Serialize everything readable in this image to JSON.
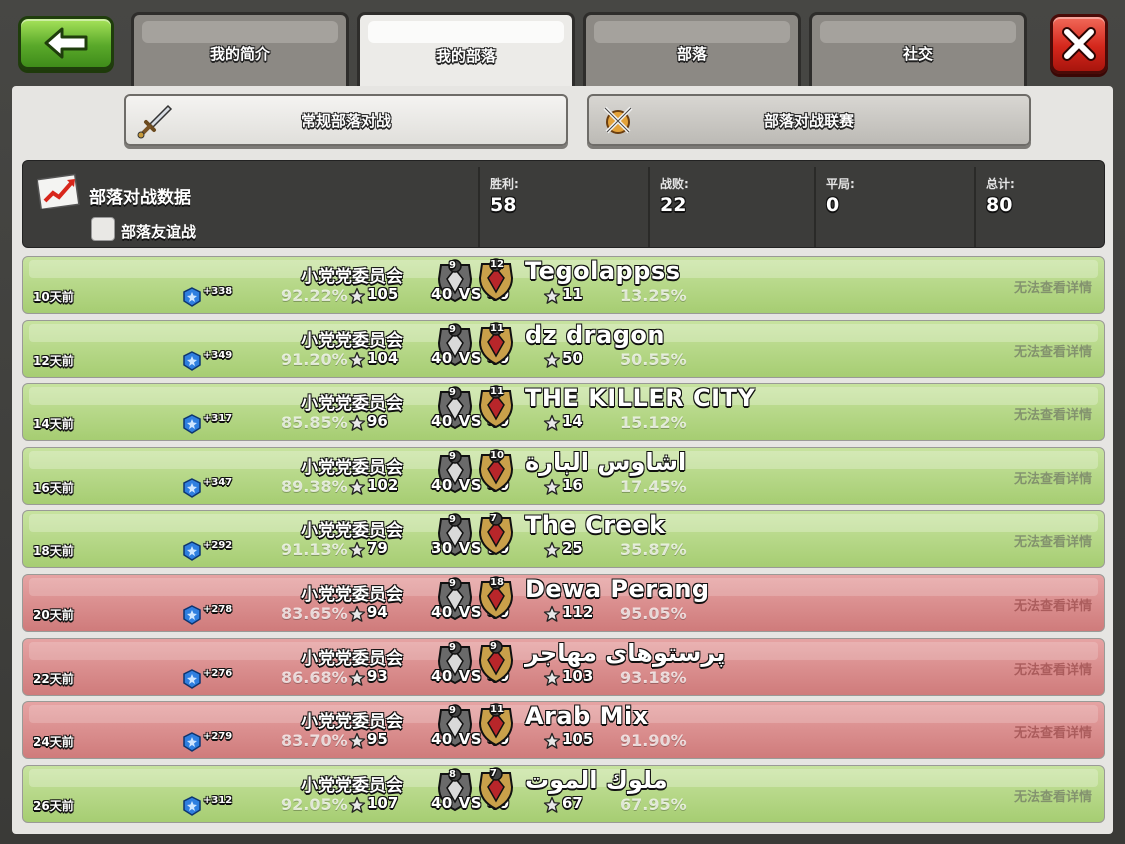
{
  "tabs": [
    {
      "label": "我的简介",
      "active": false
    },
    {
      "label": "我的部落",
      "active": true
    },
    {
      "label": "部落",
      "active": false
    },
    {
      "label": "社交",
      "active": false
    }
  ],
  "subtabs": {
    "regular": {
      "label": "常规部落对战",
      "icon": "sword-icon"
    },
    "league": {
      "label": "部落对战联赛",
      "icon": "crossed-swords-icon"
    }
  },
  "stats": {
    "title": "部落对战数据",
    "friendly_label": "部落友谊战",
    "friendly_checked": false,
    "win_label": "胜利:",
    "win": "58",
    "loss_label": "战败:",
    "loss": "22",
    "draw_label": "平局:",
    "draw": "0",
    "total_label": "总计:",
    "total": "80"
  },
  "colors": {
    "win_row": "#b7d98a",
    "lose_row": "#db8f8f",
    "back_button": "#5aa92a",
    "close_button": "#d4271c"
  },
  "wars": [
    {
      "result": "win",
      "ago": "10天前",
      "xp": "+338",
      "our_name": "小党党委员会",
      "our_pct": "92.22%",
      "our_stars": "105",
      "our_level": "9",
      "vs": "40 VS 40",
      "enemy_level": "12",
      "enemy_name": "Tegolappss",
      "enemy_stars": "11",
      "enemy_pct": "13.25%",
      "detail": "无法查看详情"
    },
    {
      "result": "win",
      "ago": "12天前",
      "xp": "+349",
      "our_name": "小党党委员会",
      "our_pct": "91.20%",
      "our_stars": "104",
      "our_level": "9",
      "vs": "40 VS 40",
      "enemy_level": "11",
      "enemy_name": "dz dragon",
      "enemy_stars": "50",
      "enemy_pct": "50.55%",
      "detail": "无法查看详情"
    },
    {
      "result": "win",
      "ago": "14天前",
      "xp": "+317",
      "our_name": "小党党委员会",
      "our_pct": "85.85%",
      "our_stars": "96",
      "our_level": "9",
      "vs": "40 VS 40",
      "enemy_level": "11",
      "enemy_name": "THE KILLER CITY",
      "enemy_stars": "14",
      "enemy_pct": "15.12%",
      "detail": "无法查看详情"
    },
    {
      "result": "win",
      "ago": "16天前",
      "xp": "+347",
      "our_name": "小党党委员会",
      "our_pct": "89.38%",
      "our_stars": "102",
      "our_level": "9",
      "vs": "40 VS 40",
      "enemy_level": "10",
      "enemy_name": "اشاوس البارة",
      "enemy_stars": "16",
      "enemy_pct": "17.45%",
      "detail": "无法查看详情"
    },
    {
      "result": "win",
      "ago": "18天前",
      "xp": "+292",
      "our_name": "小党党委员会",
      "our_pct": "91.13%",
      "our_stars": "79",
      "our_level": "9",
      "vs": "30 VS 30",
      "enemy_level": "7",
      "enemy_name": "The Creek",
      "enemy_stars": "25",
      "enemy_pct": "35.87%",
      "detail": "无法查看详情"
    },
    {
      "result": "lose",
      "ago": "20天前",
      "xp": "+278",
      "our_name": "小党党委员会",
      "our_pct": "83.65%",
      "our_stars": "94",
      "our_level": "9",
      "vs": "40 VS 40",
      "enemy_level": "18",
      "enemy_name": "Dewa Perang",
      "enemy_stars": "112",
      "enemy_pct": "95.05%",
      "detail": "无法查看详情"
    },
    {
      "result": "lose",
      "ago": "22天前",
      "xp": "+276",
      "our_name": "小党党委员会",
      "our_pct": "86.68%",
      "our_stars": "93",
      "our_level": "9",
      "vs": "40 VS 40",
      "enemy_level": "9",
      "enemy_name": "پرستوهای مهاجر",
      "enemy_stars": "103",
      "enemy_pct": "93.18%",
      "detail": "无法查看详情"
    },
    {
      "result": "lose",
      "ago": "24天前",
      "xp": "+279",
      "our_name": "小党党委员会",
      "our_pct": "83.70%",
      "our_stars": "95",
      "our_level": "9",
      "vs": "40 VS 40",
      "enemy_level": "11",
      "enemy_name": "Arab Mix",
      "enemy_stars": "105",
      "enemy_pct": "91.90%",
      "detail": "无法查看详情"
    },
    {
      "result": "win",
      "ago": "26天前",
      "xp": "+312",
      "our_name": "小党党委员会",
      "our_pct": "92.05%",
      "our_stars": "107",
      "our_level": "8",
      "vs": "40 VS 40",
      "enemy_level": "7",
      "enemy_name": "ملوك الموت",
      "enemy_stars": "67",
      "enemy_pct": "67.95%",
      "detail": "无法查看详情"
    }
  ]
}
